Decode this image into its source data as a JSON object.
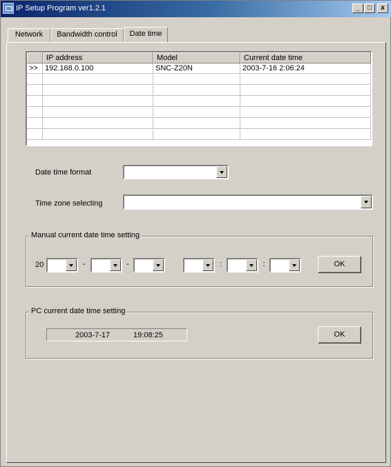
{
  "window": {
    "title": "IP Setup Program ver1.2.1",
    "minimize": "_",
    "maximize": "□",
    "close": "x"
  },
  "tabs": [
    {
      "label": "Network"
    },
    {
      "label": "Bandwidth control"
    },
    {
      "label": "Date time"
    }
  ],
  "grid": {
    "columns": [
      "IP address",
      "Model",
      "Current date time"
    ],
    "rows": [
      {
        "marker": ">>",
        "ip": "192.168.0.100",
        "model": "SNC-Z20N",
        "datetime": "2003-7-16  2:06:24"
      }
    ]
  },
  "format": {
    "label": "Date time format",
    "value": ""
  },
  "timezone": {
    "label": "Time zone selecting",
    "value": ""
  },
  "manual": {
    "title": "Manual current date time setting",
    "century": "20",
    "date_sep": "-",
    "time_sep": ":",
    "ok": "OK"
  },
  "pc": {
    "title": "PC current date time setting",
    "date": "2003-7-17",
    "time": "19:08:25",
    "ok": "OK"
  }
}
